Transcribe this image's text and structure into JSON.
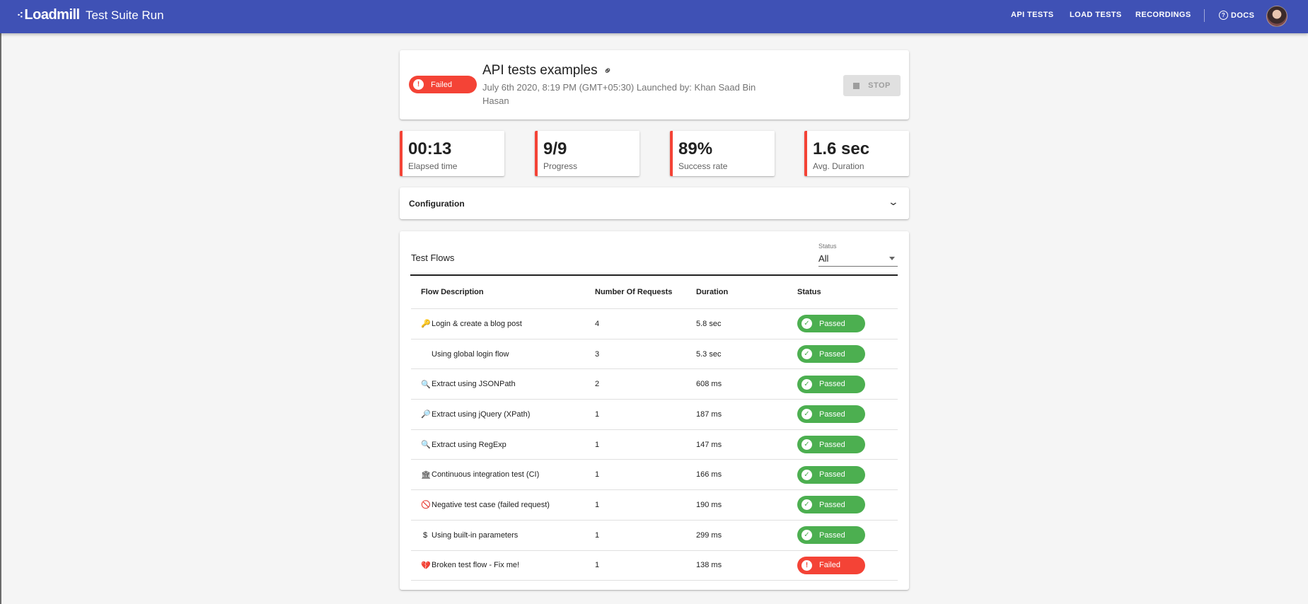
{
  "app": {
    "logo": "Loadmill",
    "title": "Test Suite Run"
  },
  "nav": {
    "api_tests": "API TESTS",
    "load_tests": "LOAD TESTS",
    "recordings": "RECORDINGS",
    "docs": "DOCS"
  },
  "suite": {
    "status": "Failed",
    "name": "API tests examples",
    "meta": "July 6th 2020, 8:19 PM (GMT+05:30) Launched by: Khan Saad Bin Hasan",
    "stop_label": "STOP"
  },
  "stats": [
    {
      "value": "00:13",
      "label": "Elapsed time"
    },
    {
      "value": "9/9",
      "label": "Progress"
    },
    {
      "value": "89%",
      "label": "Success rate"
    },
    {
      "value": "1.6 sec",
      "label": "Avg. Duration"
    }
  ],
  "configuration": {
    "title": "Configuration"
  },
  "flows": {
    "title": "Test Flows",
    "filter_label": "Status",
    "filter_value": "All",
    "columns": [
      "Flow Description",
      "Number Of Requests",
      "Duration",
      "Status"
    ],
    "rows": [
      {
        "icon": "🔑",
        "description": "Login & create a blog post",
        "requests": "4",
        "duration": "5.8 sec",
        "status": "Passed"
      },
      {
        "icon": "",
        "description": "Using global login flow",
        "requests": "3",
        "duration": "5.3 sec",
        "status": "Passed"
      },
      {
        "icon": "🔍",
        "description": "Extract using JSONPath",
        "requests": "2",
        "duration": "608 ms",
        "status": "Passed"
      },
      {
        "icon": "🔎",
        "description": "Extract using jQuery (XPath)",
        "requests": "1",
        "duration": "187 ms",
        "status": "Passed"
      },
      {
        "icon": "🔍",
        "description": "Extract using RegExp",
        "requests": "1",
        "duration": "147 ms",
        "status": "Passed"
      },
      {
        "icon": "🏛",
        "description": "Continuous integration test (CI)",
        "requests": "1",
        "duration": "166 ms",
        "status": "Passed"
      },
      {
        "icon": "🚫",
        "description": "Negative test case (failed request)",
        "requests": "1",
        "duration": "190 ms",
        "status": "Passed"
      },
      {
        "icon": "$",
        "description": "Using built-in parameters",
        "requests": "1",
        "duration": "299 ms",
        "status": "Passed"
      },
      {
        "icon": "💔",
        "description": "Broken test flow - Fix me!",
        "requests": "1",
        "duration": "138 ms",
        "status": "Failed"
      }
    ]
  },
  "colors": {
    "appbar": "#3f51b5",
    "failed": "#f44336",
    "passed": "#4caf50"
  }
}
